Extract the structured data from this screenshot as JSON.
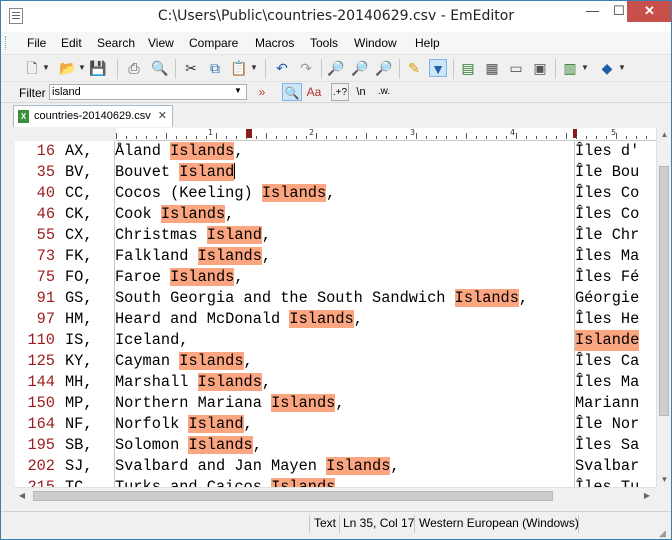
{
  "window": {
    "title": "C:\\Users\\Public\\countries-20140629.csv - EmEditor",
    "min_glyph": "—",
    "max_glyph": "☐",
    "close_glyph": "✕"
  },
  "menu": [
    "File",
    "Edit",
    "Search",
    "View",
    "Compare",
    "Macros",
    "Tools",
    "Window",
    "Help"
  ],
  "toolbar": {
    "icons": [
      "new-file-icon",
      "open-folder-icon",
      "save-icon",
      "print-icon",
      "print-preview-icon",
      "cut-icon",
      "copy-icon",
      "paste-icon",
      "undo-icon",
      "redo-icon",
      "find-icon",
      "find-next-icon",
      "find-previous-icon",
      "highlight-search-icon",
      "filter-icon",
      "csv-mode-icon",
      "tab-separated-icon",
      "comma-separated-icon",
      "layout-icon",
      "macro-icon",
      "plugins-icon"
    ]
  },
  "filter": {
    "label": "Filter",
    "value": "island",
    "advanced_glyph": "»",
    "match_case_label": "Aa",
    "regex_label": ".+?",
    "escape_label": "\\n",
    "whole_word_label": ".w."
  },
  "tab": {
    "label": "countries-20140629.csv",
    "close_glyph": "✕",
    "icon_text": "X"
  },
  "ruler": {
    "labels": [
      "1",
      "2",
      "3",
      "4",
      "5"
    ]
  },
  "rows": [
    {
      "ln": "16",
      "code": "AX,",
      "pre": "Åland ",
      "hit": "Islands",
      "post": ",",
      "fr": "Îles d'"
    },
    {
      "ln": "35",
      "code": "BV,",
      "pre": "Bouvet ",
      "hit": "Island",
      "post": "",
      "fr": "Île Bou"
    },
    {
      "ln": "40",
      "code": "CC,",
      "pre": "Cocos (Keeling) ",
      "hit": "Islands",
      "post": ",",
      "fr": "Îles Co"
    },
    {
      "ln": "46",
      "code": "CK,",
      "pre": "Cook ",
      "hit": "Islands",
      "post": ",",
      "fr": "Îles Co"
    },
    {
      "ln": "55",
      "code": "CX,",
      "pre": "Christmas ",
      "hit": "Island",
      "post": ",",
      "fr": "Île Chr"
    },
    {
      "ln": "73",
      "code": "FK,",
      "pre": "Falkland ",
      "hit": "Islands",
      "post": ",",
      "fr": "Îles Ma"
    },
    {
      "ln": "75",
      "code": "FO,",
      "pre": "Faroe ",
      "hit": "Islands",
      "post": ",",
      "fr": "Îles Fé"
    },
    {
      "ln": "91",
      "code": "GS,",
      "pre": "South Georgia and the South Sandwich ",
      "hit": "Islands",
      "post": ",",
      "fr": "Géorgie"
    },
    {
      "ln": "97",
      "code": "HM,",
      "pre": "Heard and McDonald ",
      "hit": "Islands",
      "post": ",",
      "fr": "Îles He"
    },
    {
      "ln": "110",
      "code": "IS,",
      "pre": "Iceland,",
      "hit": "",
      "post": "",
      "fr": "Islande",
      "frhit": true
    },
    {
      "ln": "125",
      "code": "KY,",
      "pre": "Cayman ",
      "hit": "Islands",
      "post": ",",
      "fr": "Îles Ca"
    },
    {
      "ln": "144",
      "code": "MH,",
      "pre": "Marshall ",
      "hit": "Islands",
      "post": ",",
      "fr": "Îles Ma"
    },
    {
      "ln": "150",
      "code": "MP,",
      "pre": "Northern Mariana ",
      "hit": "Islands",
      "post": ",",
      "fr": "Mariann"
    },
    {
      "ln": "164",
      "code": "NF,",
      "pre": "Norfolk ",
      "hit": "Island",
      "post": ",",
      "fr": "Île Nor"
    },
    {
      "ln": "195",
      "code": "SB,",
      "pre": "Solomon ",
      "hit": "Islands",
      "post": ",",
      "fr": "Îles Sa"
    },
    {
      "ln": "202",
      "code": "SJ,",
      "pre": "Svalbard and Jan Mayen ",
      "hit": "Islands",
      "post": ",",
      "fr": "Svalbar"
    },
    {
      "ln": "215",
      "code": "TC,",
      "pre": "Turks and Caicos ",
      "hit": "Islands",
      "post": ",",
      "fr": "Îles Tu"
    }
  ],
  "status": {
    "mode": "Text",
    "position": "Ln 35, Col 17",
    "encoding": "Western European (Windows)"
  },
  "colors": {
    "highlight": "#fca581",
    "line_number": "#9b1c1c",
    "close_button": "#c7504a"
  }
}
